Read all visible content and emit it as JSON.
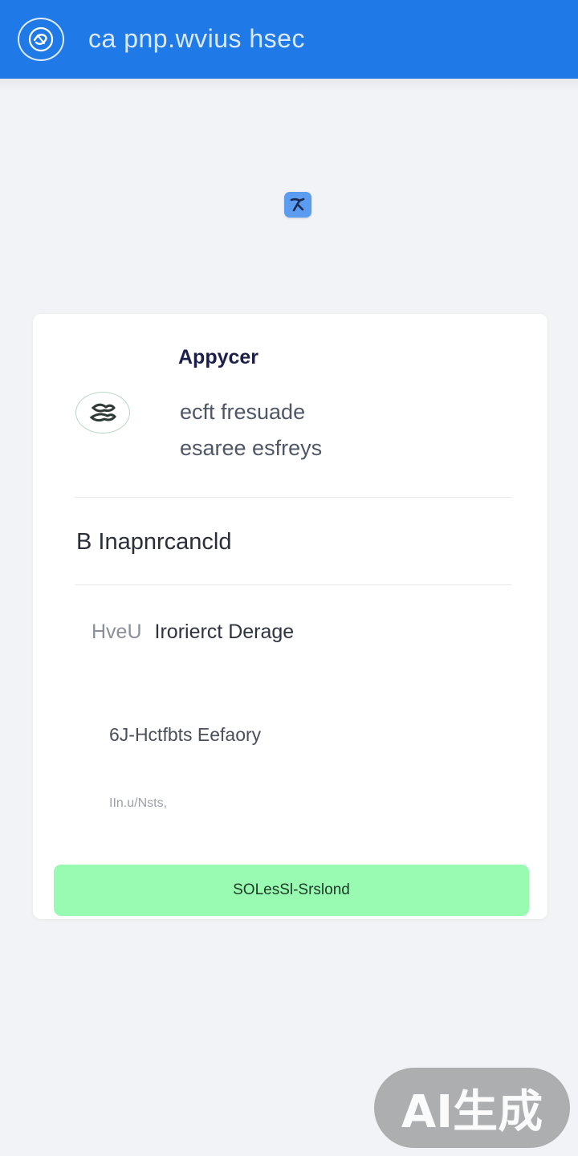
{
  "header": {
    "title": "ca pnp.wvius hsec",
    "logo_icon": "swirl-logo-icon",
    "color": "#1f7ae8"
  },
  "app_badge": {
    "icon": "wrench-cross-icon",
    "color": "#5b9cf0"
  },
  "card": {
    "app_name": "Appycer",
    "desc_line_1": "ecft fresuade",
    "desc_line_2": "esaree esfreys",
    "avatar_icon": "app-avatar-icon",
    "section_title": "B  Inapnrcancld",
    "row_1_tag": "HveU",
    "row_1_label": "Irorierct Derage",
    "row_2_label": "6J-Hctfbts Eefaory",
    "row_3_label": "IIn.u/Nsts,",
    "button_label": "SOLesSl-Srslond",
    "button_color": "#98fbb1"
  },
  "watermark": {
    "text": "AI生成"
  }
}
